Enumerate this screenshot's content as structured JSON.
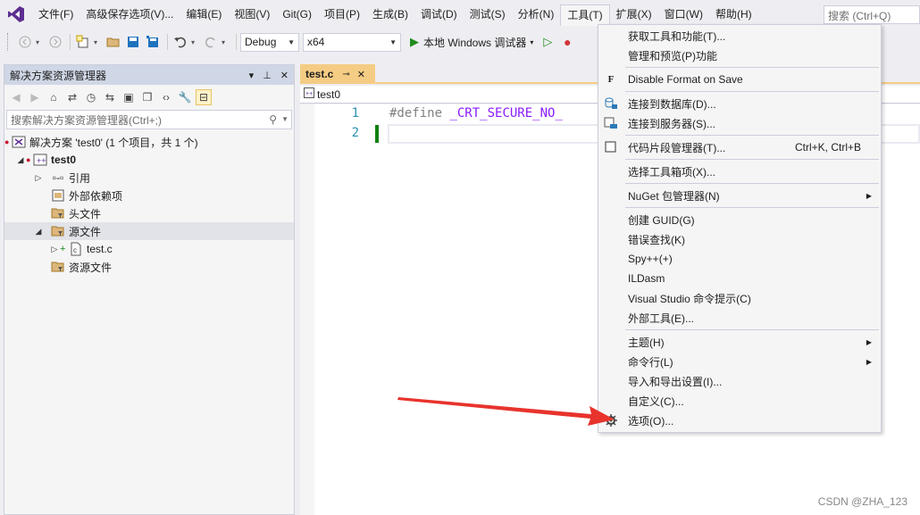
{
  "menubar": {
    "items": [
      "文件(F)",
      "高级保存选项(V)...",
      "编辑(E)",
      "视图(V)",
      "Git(G)",
      "项目(P)",
      "生成(B)",
      "调试(D)",
      "测试(S)",
      "分析(N)",
      "工具(T)",
      "扩展(X)",
      "窗口(W)",
      "帮助(H)"
    ],
    "active_index": 10,
    "search_placeholder": "搜索 (Ctrl+Q)"
  },
  "toolbar": {
    "config": "Debug",
    "platform": "x64",
    "run_label": "本地 Windows 调试器"
  },
  "solution_explorer": {
    "title": "解决方案资源管理器",
    "search_placeholder": "搜索解决方案资源管理器(Ctrl+;)",
    "solution_label": "解决方案 'test0' (1 个项目，共 1 个)",
    "project": "test0",
    "nodes": {
      "references": "引用",
      "external_deps": "外部依赖项",
      "header_files": "头文件",
      "source_files": "源文件",
      "test_c": "test.c",
      "resource_files": "资源文件"
    }
  },
  "editor": {
    "tab_label": "test.c",
    "nav_scope": "test0",
    "lines": [
      {
        "num": "1",
        "text_pp": "#define ",
        "text_macro": "_CRT_SECURE_NO_"
      },
      {
        "num": "2",
        "text_pp": "",
        "text_macro": ""
      }
    ]
  },
  "tools_menu": {
    "items": [
      {
        "label": "获取工具和功能(T)...",
        "icon": "",
        "shortcut": "",
        "submenu": false
      },
      {
        "label": "管理和预览(P)功能",
        "icon": "",
        "shortcut": "",
        "submenu": false
      },
      {
        "label": "Disable Format on Save",
        "icon": "F",
        "shortcut": "",
        "submenu": false
      },
      {
        "label": "连接到数据库(D)...",
        "icon": "database-icon",
        "shortcut": "",
        "submenu": false
      },
      {
        "label": "连接到服务器(S)...",
        "icon": "server-icon",
        "shortcut": "",
        "submenu": false
      },
      {
        "label": "代码片段管理器(T)...",
        "icon": "checkbox-icon",
        "shortcut": "Ctrl+K, Ctrl+B",
        "submenu": false
      },
      {
        "label": "选择工具箱项(X)...",
        "icon": "",
        "shortcut": "",
        "submenu": false
      },
      {
        "label": "NuGet 包管理器(N)",
        "icon": "",
        "shortcut": "",
        "submenu": true
      },
      {
        "label": "创建 GUID(G)",
        "icon": "",
        "shortcut": "",
        "submenu": false
      },
      {
        "label": "错误查找(K)",
        "icon": "",
        "shortcut": "",
        "submenu": false
      },
      {
        "label": "Spy++(+)",
        "icon": "",
        "shortcut": "",
        "submenu": false
      },
      {
        "label": "ILDasm",
        "icon": "",
        "shortcut": "",
        "submenu": false
      },
      {
        "label": "Visual Studio 命令提示(C)",
        "icon": "",
        "shortcut": "",
        "submenu": false
      },
      {
        "label": "外部工具(E)...",
        "icon": "",
        "shortcut": "",
        "submenu": false
      },
      {
        "label": "主题(H)",
        "icon": "",
        "shortcut": "",
        "submenu": true
      },
      {
        "label": "命令行(L)",
        "icon": "",
        "shortcut": "",
        "submenu": true
      },
      {
        "label": "导入和导出设置(I)...",
        "icon": "",
        "shortcut": "",
        "submenu": false
      },
      {
        "label": "自定义(C)...",
        "icon": "",
        "shortcut": "",
        "submenu": false
      },
      {
        "label": "选项(O)...",
        "icon": "gear-icon",
        "shortcut": "",
        "submenu": false
      }
    ]
  },
  "watermark": "CSDN @ZHA_123",
  "colors": {
    "accent_tab": "#f5cc84",
    "arrow": "#e8332d",
    "vs_purple": "#5c2d91"
  }
}
